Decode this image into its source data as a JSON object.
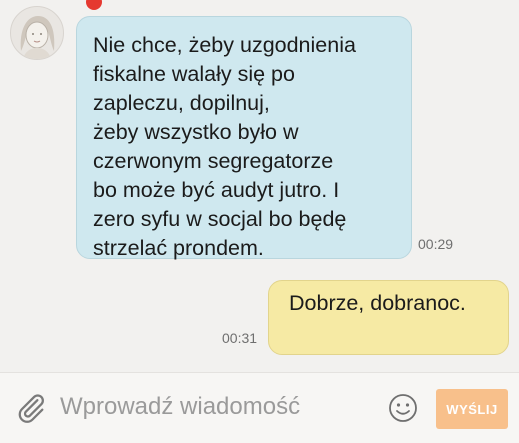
{
  "messages": [
    {
      "direction": "incoming",
      "text": "Nie chce, żeby uzgodnienia\nfiskalne walały się po\nzapleczu, dopilnuj,\nżeby wszystko było w\nczerwonym segregatorze\nbo może być audyt jutro. I\nzero syfu w socjal bo będę\nstrzelać prondem.",
      "time": "00:29",
      "bubble_color": "#cfe8ef"
    },
    {
      "direction": "outgoing",
      "text": "Dobrze, dobranoc.",
      "time": "00:31",
      "bubble_color": "#f6eaa4"
    }
  ],
  "contact": {
    "avatar_icon": "female-avatar-icon",
    "unread_indicator_color": "#e53930"
  },
  "composer": {
    "attach_icon": "paperclip-icon",
    "placeholder": "Wprowadź wiadomość",
    "value": "",
    "emoji_icon": "smiley-icon",
    "send_label": "WYŚLIJ",
    "send_color": "#f8c08b"
  }
}
